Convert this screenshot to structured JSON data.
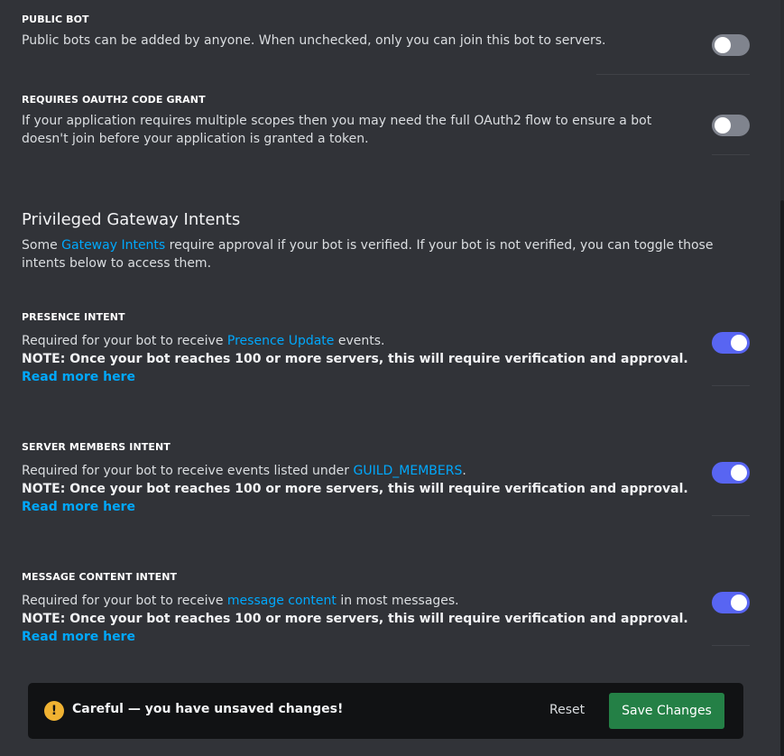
{
  "public_bot": {
    "label": "PUBLIC BOT",
    "description": "Public bots can be added by anyone. When unchecked, only you can join this bot to servers.",
    "enabled": false
  },
  "oauth2_grant": {
    "label": "REQUIRES OAUTH2 CODE GRANT",
    "description": "If your application requires multiple scopes then you may need the full OAuth2 flow to ensure a bot doesn't join before your application is granted a token.",
    "enabled": false
  },
  "privileged": {
    "title": "Privileged Gateway Intents",
    "desc_before": "Some ",
    "desc_link": "Gateway Intents",
    "desc_after": " require approval if your bot is verified. If your bot is not verified, you can toggle those intents below to access them."
  },
  "presence_intent": {
    "label": "PRESENCE INTENT",
    "desc_before": "Required for your bot to receive ",
    "desc_link": "Presence Update",
    "desc_after": " events.",
    "note": "NOTE: Once your bot reaches 100 or more servers, this will require verification and approval. ",
    "read_more": "Read more here",
    "enabled": true
  },
  "server_members_intent": {
    "label": "SERVER MEMBERS INTENT",
    "desc_before": "Required for your bot to receive events listed under ",
    "desc_link": "GUILD_MEMBERS",
    "desc_after": ".",
    "note": "NOTE: Once your bot reaches 100 or more servers, this will require verification and approval. ",
    "read_more": "Read more here",
    "enabled": true
  },
  "message_content_intent": {
    "label": "MESSAGE CONTENT INTENT",
    "desc_before": "Required for your bot to receive ",
    "desc_link": "message content",
    "desc_after": " in most messages.",
    "note": "NOTE: Once your bot reaches 100 or more servers, this will require verification and approval. ",
    "read_more": "Read more here",
    "enabled": true
  },
  "unsaved_notice": {
    "icon": "!",
    "message": "Careful — you have unsaved changes!",
    "reset_label": "Reset",
    "save_label": "Save Changes"
  },
  "colors": {
    "background": "#313338",
    "link": "#00a8fc",
    "toggle_on": "#5865f2",
    "toggle_off": "#80848e",
    "save_button": "#248046",
    "warning": "#f0b232"
  }
}
